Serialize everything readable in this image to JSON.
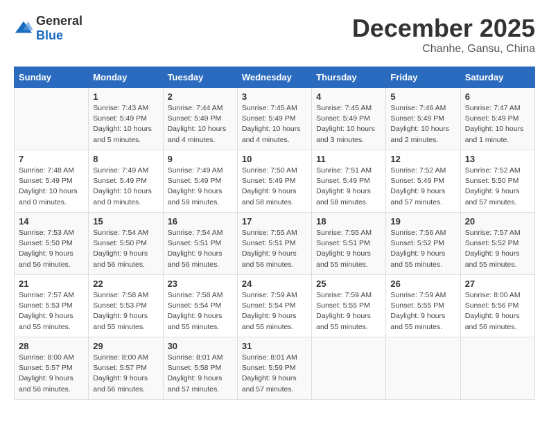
{
  "logo": {
    "general": "General",
    "blue": "Blue"
  },
  "header": {
    "month": "December 2025",
    "location": "Chanhe, Gansu, China"
  },
  "weekdays": [
    "Sunday",
    "Monday",
    "Tuesday",
    "Wednesday",
    "Thursday",
    "Friday",
    "Saturday"
  ],
  "weeks": [
    [
      {
        "day": "",
        "info": ""
      },
      {
        "day": "1",
        "info": "Sunrise: 7:43 AM\nSunset: 5:49 PM\nDaylight: 10 hours\nand 5 minutes."
      },
      {
        "day": "2",
        "info": "Sunrise: 7:44 AM\nSunset: 5:49 PM\nDaylight: 10 hours\nand 4 minutes."
      },
      {
        "day": "3",
        "info": "Sunrise: 7:45 AM\nSunset: 5:49 PM\nDaylight: 10 hours\nand 4 minutes."
      },
      {
        "day": "4",
        "info": "Sunrise: 7:45 AM\nSunset: 5:49 PM\nDaylight: 10 hours\nand 3 minutes."
      },
      {
        "day": "5",
        "info": "Sunrise: 7:46 AM\nSunset: 5:49 PM\nDaylight: 10 hours\nand 2 minutes."
      },
      {
        "day": "6",
        "info": "Sunrise: 7:47 AM\nSunset: 5:49 PM\nDaylight: 10 hours\nand 1 minute."
      }
    ],
    [
      {
        "day": "7",
        "info": "Sunrise: 7:48 AM\nSunset: 5:49 PM\nDaylight: 10 hours\nand 0 minutes."
      },
      {
        "day": "8",
        "info": "Sunrise: 7:49 AM\nSunset: 5:49 PM\nDaylight: 10 hours\nand 0 minutes."
      },
      {
        "day": "9",
        "info": "Sunrise: 7:49 AM\nSunset: 5:49 PM\nDaylight: 9 hours\nand 59 minutes."
      },
      {
        "day": "10",
        "info": "Sunrise: 7:50 AM\nSunset: 5:49 PM\nDaylight: 9 hours\nand 58 minutes."
      },
      {
        "day": "11",
        "info": "Sunrise: 7:51 AM\nSunset: 5:49 PM\nDaylight: 9 hours\nand 58 minutes."
      },
      {
        "day": "12",
        "info": "Sunrise: 7:52 AM\nSunset: 5:49 PM\nDaylight: 9 hours\nand 57 minutes."
      },
      {
        "day": "13",
        "info": "Sunrise: 7:52 AM\nSunset: 5:50 PM\nDaylight: 9 hours\nand 57 minutes."
      }
    ],
    [
      {
        "day": "14",
        "info": "Sunrise: 7:53 AM\nSunset: 5:50 PM\nDaylight: 9 hours\nand 56 minutes."
      },
      {
        "day": "15",
        "info": "Sunrise: 7:54 AM\nSunset: 5:50 PM\nDaylight: 9 hours\nand 56 minutes."
      },
      {
        "day": "16",
        "info": "Sunrise: 7:54 AM\nSunset: 5:51 PM\nDaylight: 9 hours\nand 56 minutes."
      },
      {
        "day": "17",
        "info": "Sunrise: 7:55 AM\nSunset: 5:51 PM\nDaylight: 9 hours\nand 56 minutes."
      },
      {
        "day": "18",
        "info": "Sunrise: 7:55 AM\nSunset: 5:51 PM\nDaylight: 9 hours\nand 55 minutes."
      },
      {
        "day": "19",
        "info": "Sunrise: 7:56 AM\nSunset: 5:52 PM\nDaylight: 9 hours\nand 55 minutes."
      },
      {
        "day": "20",
        "info": "Sunrise: 7:57 AM\nSunset: 5:52 PM\nDaylight: 9 hours\nand 55 minutes."
      }
    ],
    [
      {
        "day": "21",
        "info": "Sunrise: 7:57 AM\nSunset: 5:53 PM\nDaylight: 9 hours\nand 55 minutes."
      },
      {
        "day": "22",
        "info": "Sunrise: 7:58 AM\nSunset: 5:53 PM\nDaylight: 9 hours\nand 55 minutes."
      },
      {
        "day": "23",
        "info": "Sunrise: 7:58 AM\nSunset: 5:54 PM\nDaylight: 9 hours\nand 55 minutes."
      },
      {
        "day": "24",
        "info": "Sunrise: 7:59 AM\nSunset: 5:54 PM\nDaylight: 9 hours\nand 55 minutes."
      },
      {
        "day": "25",
        "info": "Sunrise: 7:59 AM\nSunset: 5:55 PM\nDaylight: 9 hours\nand 55 minutes."
      },
      {
        "day": "26",
        "info": "Sunrise: 7:59 AM\nSunset: 5:55 PM\nDaylight: 9 hours\nand 55 minutes."
      },
      {
        "day": "27",
        "info": "Sunrise: 8:00 AM\nSunset: 5:56 PM\nDaylight: 9 hours\nand 56 minutes."
      }
    ],
    [
      {
        "day": "28",
        "info": "Sunrise: 8:00 AM\nSunset: 5:57 PM\nDaylight: 9 hours\nand 56 minutes."
      },
      {
        "day": "29",
        "info": "Sunrise: 8:00 AM\nSunset: 5:57 PM\nDaylight: 9 hours\nand 56 minutes."
      },
      {
        "day": "30",
        "info": "Sunrise: 8:01 AM\nSunset: 5:58 PM\nDaylight: 9 hours\nand 57 minutes."
      },
      {
        "day": "31",
        "info": "Sunrise: 8:01 AM\nSunset: 5:59 PM\nDaylight: 9 hours\nand 57 minutes."
      },
      {
        "day": "",
        "info": ""
      },
      {
        "day": "",
        "info": ""
      },
      {
        "day": "",
        "info": ""
      }
    ]
  ]
}
